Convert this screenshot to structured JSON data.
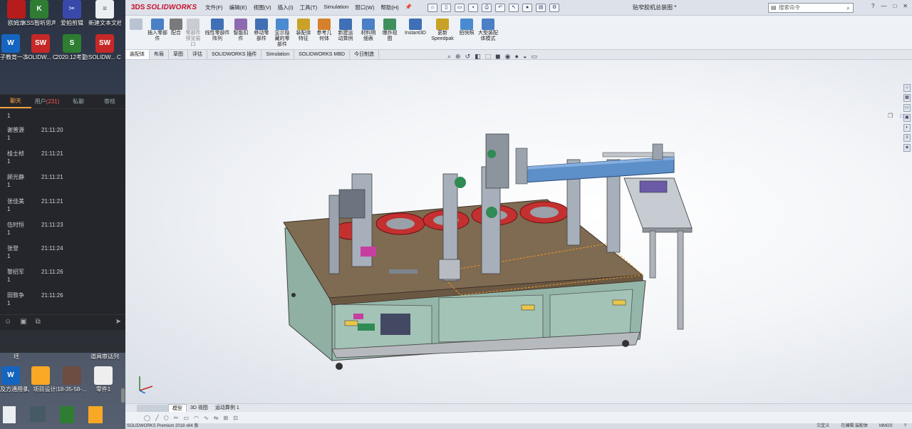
{
  "desktop": {
    "icons": [
      {
        "label": "欧姆龙",
        "color": "#b71c1c",
        "glyph": "BEST"
      },
      {
        "label": "KSS暂听思声卡控制面板...",
        "color": "#2e7d32",
        "glyph": "K"
      },
      {
        "label": "爱拍剪辑",
        "color": "#3949ab",
        "glyph": "✂"
      },
      {
        "label": "新建文本文档 (9)",
        "color": "#eceff1",
        "glyph": "≡"
      },
      {
        "label": "丸子教育一次培...",
        "color": "#1565c0",
        "glyph": "W"
      },
      {
        "label": "SOLIDW... Compose...",
        "color": "#c62828",
        "glyph": "SW"
      },
      {
        "label": "2020.12考勤报表",
        "color": "#2e7d32",
        "glyph": "S"
      },
      {
        "label": "SOLIDW... Compose...",
        "color": "#c62828",
        "glyph": "SW"
      },
      {
        "label": "坯",
        "color": "#546e7a",
        "glyph": ""
      },
      {
        "label": "道具审话列",
        "color": "#546e7a",
        "glyph": ""
      },
      {
        "label": "材及方通用参考",
        "color": "#1565c0",
        "glyph": "W"
      },
      {
        "label": "3、项目设计班",
        "color": "#f9a825",
        "glyph": ""
      },
      {
        "label": "18-35-58-...",
        "color": "#6d4c41",
        "glyph": ""
      },
      {
        "label": "零件1",
        "color": "#c62828",
        "glyph": ""
      }
    ]
  },
  "chat": {
    "tabs": [
      "聊天",
      "用户",
      "(231)",
      "私聊",
      "审核"
    ],
    "messages": [
      {
        "name": "",
        "time": "",
        "value": "1"
      },
      {
        "name": "谢普源",
        "time": "21:11:20",
        "value": "1"
      },
      {
        "name": "桂士桢",
        "time": "21:11:21",
        "value": "1"
      },
      {
        "name": "顾光静",
        "time": "21:11:21",
        "value": "1"
      },
      {
        "name": "张佳美",
        "time": "21:11:21",
        "value": "1"
      },
      {
        "name": "伍时恒",
        "time": "21:11:23",
        "value": "1"
      },
      {
        "name": "张誉",
        "time": "21:11:24",
        "value": "1"
      },
      {
        "name": "黎招军",
        "time": "21:11:26",
        "value": "1"
      },
      {
        "name": "田致争",
        "time": "21:11:26",
        "value": "1"
      }
    ]
  },
  "solidworks": {
    "brand_ds": "3DS",
    "brand_sw": "SOLIDWORKS",
    "menus": [
      "文件(F)",
      "编辑(E)",
      "视图(V)",
      "插入(I)",
      "工具(T)",
      "Simulation",
      "窗口(W)",
      "帮助(H)"
    ],
    "doc_title": "贴窄胶机总装图 *",
    "search_placeholder": "搜索命令",
    "window_controls": [
      "?",
      "—",
      "□",
      "✕"
    ],
    "ribbon": [
      {
        "label": "插入零部件",
        "color": "#4b7fc6",
        "enabled": true
      },
      {
        "label": "配合",
        "color": "#7a7a7a",
        "enabled": true
      },
      {
        "label": "零部件预览窗口",
        "color": "#aaaaaa",
        "enabled": false
      },
      {
        "label": "线性零部件阵列",
        "color": "#3f6fb5",
        "enabled": true
      },
      {
        "label": "智能扣件",
        "color": "#8e6bb0",
        "enabled": true
      },
      {
        "label": "移动零部件",
        "color": "#3f6fb5",
        "enabled": true
      },
      {
        "label": "显示隐藏的零部件",
        "color": "#4a8ad0",
        "enabled": true
      },
      {
        "label": "装配体特征",
        "color": "#c9a227",
        "enabled": true
      },
      {
        "label": "参考几何体",
        "color": "#d6802c",
        "enabled": true
      },
      {
        "label": "新建运动算例",
        "color": "#3f6fb5",
        "enabled": true
      },
      {
        "label": "材料明细表",
        "color": "#4b7fc6",
        "enabled": true
      },
      {
        "label": "爆炸视图",
        "color": "#3f8f5c",
        "enabled": true
      },
      {
        "label": "Instant3D",
        "color": "#3f6fb5",
        "enabled": true
      },
      {
        "label": "更新Speedpak",
        "color": "#c8a227",
        "enabled": true
      },
      {
        "label": "拍快照",
        "color": "#4a8ad0",
        "enabled": true
      },
      {
        "label": "大型装配体模式",
        "color": "#4b7fc6",
        "enabled": true
      }
    ],
    "command_tabs": [
      "装配体",
      "布局",
      "草图",
      "评估",
      "SOLIDWORKS 插件",
      "Simulation",
      "SOLIDWORKS MBD",
      "今日制造"
    ],
    "active_command_tab": "装配体",
    "bottom_tabs": [
      "模型",
      "3D 视图",
      "运动算例 1"
    ],
    "active_bottom_tab": "模型",
    "status_left": "SOLIDWORKS Premium 2018 x64 版",
    "status_right": [
      "欠定义",
      "在编辑 装配体",
      "MMGS",
      "?"
    ]
  }
}
